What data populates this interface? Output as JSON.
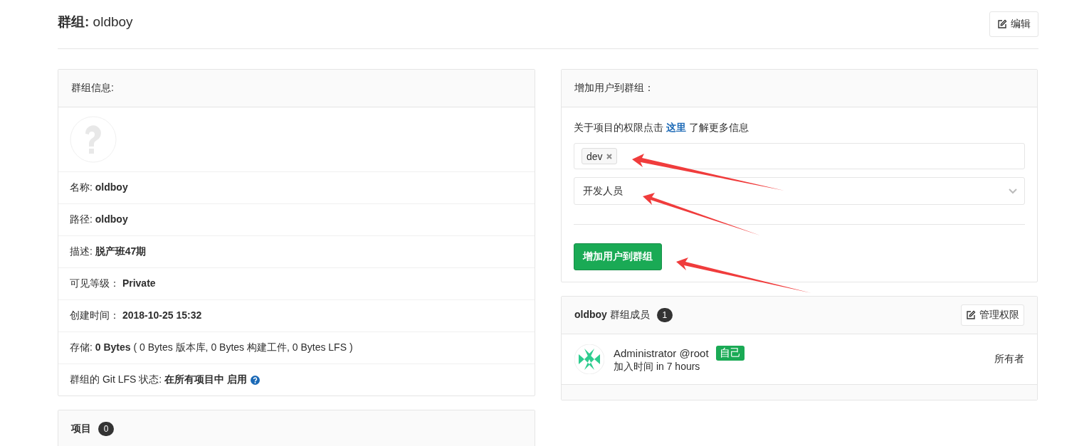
{
  "page": {
    "title_label": "群组:",
    "title_name": "oldboy",
    "edit_button": "编辑"
  },
  "group_info": {
    "heading": "群组信息:",
    "rows": [
      {
        "kind": "plain",
        "label": "名称:",
        "value": "oldboy"
      },
      {
        "kind": "plain",
        "label": "路径:",
        "value": "oldboy"
      },
      {
        "kind": "plain",
        "label": "描述:",
        "value": "脱产班47期"
      },
      {
        "kind": "plain",
        "label": "可见等级：",
        "value": "Private"
      },
      {
        "kind": "plain",
        "label": "创建时间：",
        "value": "2018-10-25 15:32"
      },
      {
        "kind": "storage",
        "label": "存储:",
        "value": "0 Bytes",
        "note": "( 0 Bytes 版本库, 0 Bytes 构建工件, 0 Bytes LFS )"
      },
      {
        "kind": "help",
        "label": "群组的 Git LFS 状态:",
        "value": "在所有项目中 启用"
      }
    ]
  },
  "projects": {
    "heading": "项目",
    "count": "0"
  },
  "add_user": {
    "heading": "增加用户到群组：",
    "hint_before": "关于项目的权限点击",
    "hint_link": "这里",
    "hint_after": "了解更多信息",
    "tokens": [
      "dev"
    ],
    "role": "开发人员",
    "submit": "增加用户到群组"
  },
  "members": {
    "group": "oldboy",
    "heading": "群组成员",
    "count": "1",
    "manage_button": "管理权限",
    "list": [
      {
        "name": "Administrator",
        "username": "@root",
        "badge": "自己",
        "joined": "加入时间 in 7 hours",
        "role": "所有者"
      }
    ]
  }
}
